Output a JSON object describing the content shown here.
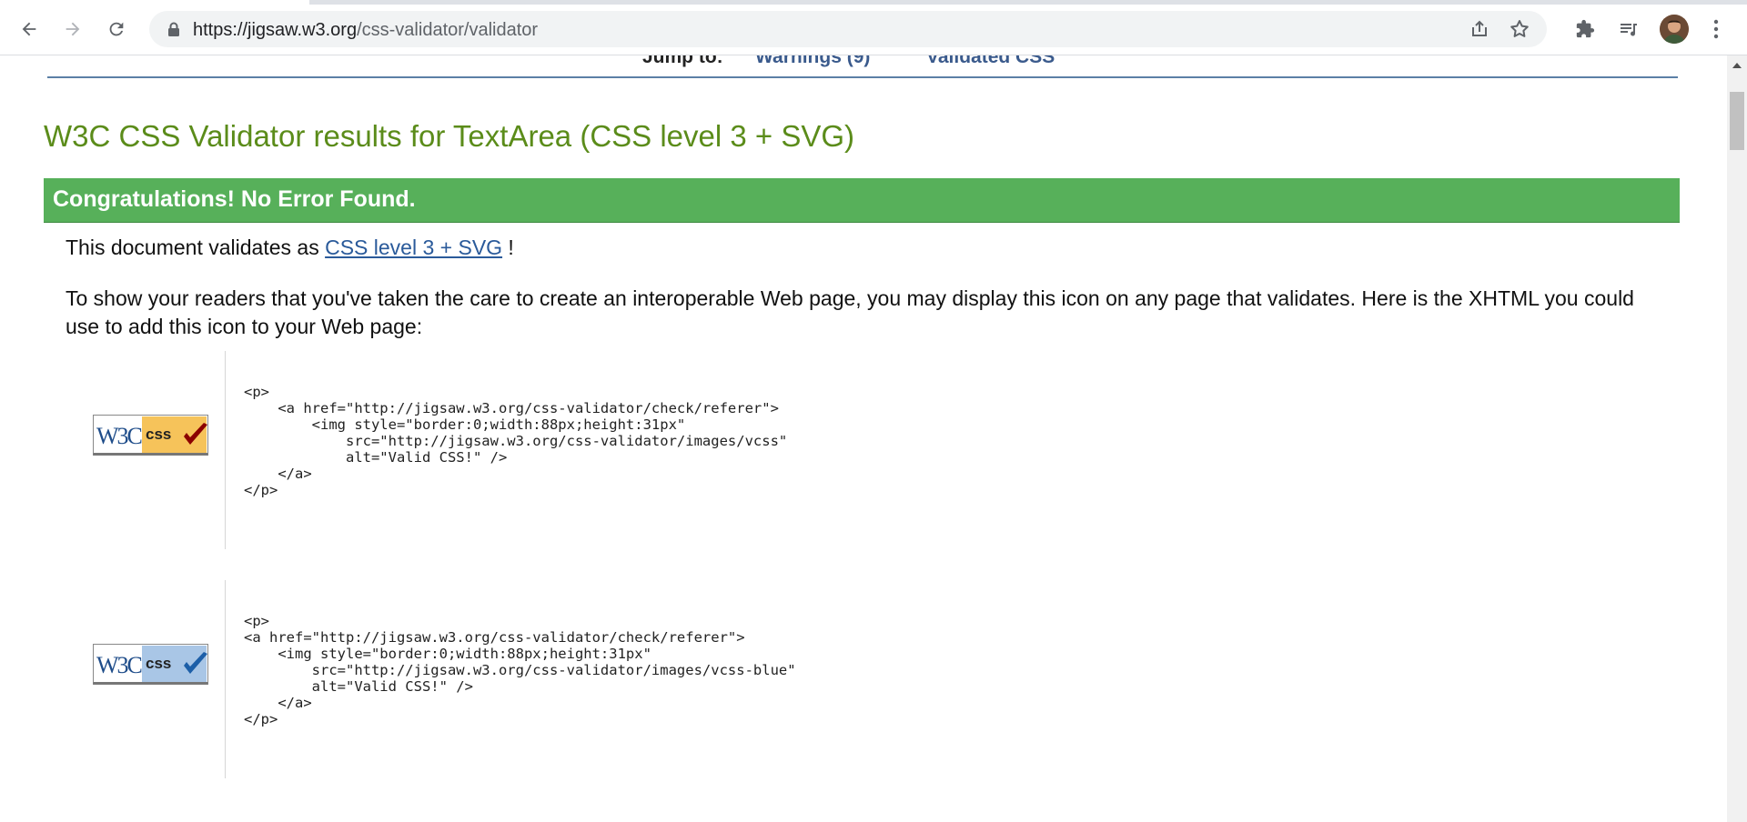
{
  "browser": {
    "url_host": "https://jigsaw.w3.org",
    "url_path": "/css-validator/validator",
    "icons": [
      "back-arrow-icon",
      "forward-arrow-icon",
      "reload-icon",
      "lock-icon",
      "share-icon",
      "star-icon",
      "puzzle-icon",
      "media-queue-icon",
      "avatar",
      "kebab-menu-icon"
    ]
  },
  "jump": {
    "label": "Jump to:",
    "warnings": "Warnings (9)",
    "validated": "Validated CSS"
  },
  "results": {
    "title": "W3C CSS Validator results for TextArea (CSS level 3 + SVG)",
    "banner": "Congratulations! No Error Found.",
    "validates_prefix": "This document validates as ",
    "validates_link": "CSS level 3 + SVG",
    "validates_suffix": " !",
    "paragraph": "To show your readers that you've taken the care to create an interoperable Web page, you may display this icon on any page that validates. Here is the XHTML you could use to add this icon to your Web page:"
  },
  "badges": [
    {
      "w3c": "W3C",
      "css": "css",
      "color": "#f6c35a",
      "check": "#8b0000",
      "code": "<p>\n    <a href=\"http://jigsaw.w3.org/css-validator/check/referer\">\n        <img style=\"border:0;width:88px;height:31px\"\n            src=\"http://jigsaw.w3.org/css-validator/images/vcss\"\n            alt=\"Valid CSS!\" />\n    </a>\n</p>"
    },
    {
      "w3c": "W3C",
      "css": "css",
      "color": "#a9c6e6",
      "check": "#1d5fa8",
      "code": "<p>\n<a href=\"http://jigsaw.w3.org/css-validator/check/referer\">\n    <img style=\"border:0;width:88px;height:31px\"\n        src=\"http://jigsaw.w3.org/css-validator/images/vcss-blue\"\n        alt=\"Valid CSS!\" />\n    </a>\n</p>"
    }
  ],
  "colors": {
    "title": "#5b8c1a",
    "banner": "#57b05a",
    "link": "#2a5a9a"
  }
}
